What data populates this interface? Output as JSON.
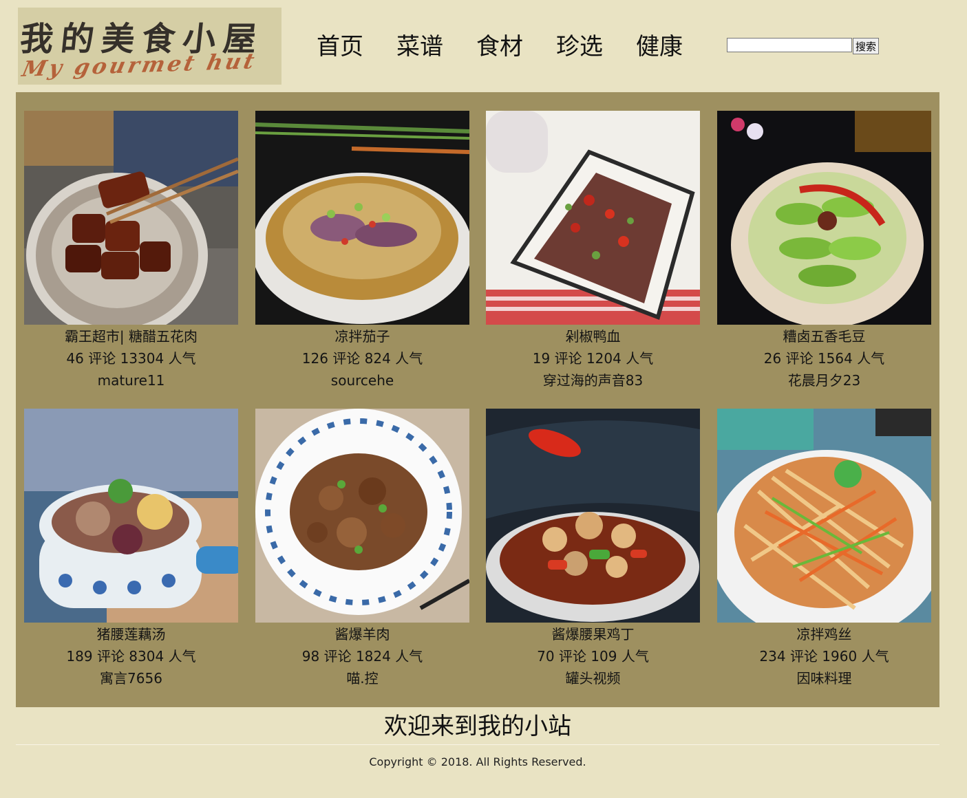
{
  "header": {
    "logo_cn": "我的美食小屋",
    "logo_en": "My gourmet hut",
    "nav": [
      "首页",
      "菜谱",
      "食材",
      "珍选",
      "健康"
    ],
    "search": {
      "value": "",
      "button_label": "搜索"
    }
  },
  "recipes": [
    {
      "title": "霸王超市| 糖醋五花肉",
      "stats": "46 评论 13304 人气",
      "author": "mature11"
    },
    {
      "title": "凉拌茄子",
      "stats": "126 评论 824 人气",
      "author": "sourcehe"
    },
    {
      "title": "剁椒鸭血",
      "stats": "19 评论 1204 人气",
      "author": "穿过海的声音83"
    },
    {
      "title": "糟卤五香毛豆",
      "stats": "26 评论 1564 人气",
      "author": "花晨月夕23"
    },
    {
      "title": "猪腰莲藕汤",
      "stats": "189 评论 8304 人气",
      "author": "寓言7656"
    },
    {
      "title": "酱爆羊肉",
      "stats": "98 评论 1824 人气",
      "author": "喵.控"
    },
    {
      "title": "酱爆腰果鸡丁",
      "stats": "70 评论 109 人气",
      "author": "罐头视频"
    },
    {
      "title": "凉拌鸡丝",
      "stats": "234 评论 1960 人气",
      "author": "因味料理"
    }
  ],
  "footer": {
    "welcome": "欢迎来到我的小站",
    "copyright": "Copyright © 2018. All Rights Reserved."
  },
  "colors": {
    "page_bg": "#e9e3c3",
    "grid_bg": "#9e9060",
    "logo_bg": "#d5cea5",
    "logo_en": "#b5623a"
  }
}
